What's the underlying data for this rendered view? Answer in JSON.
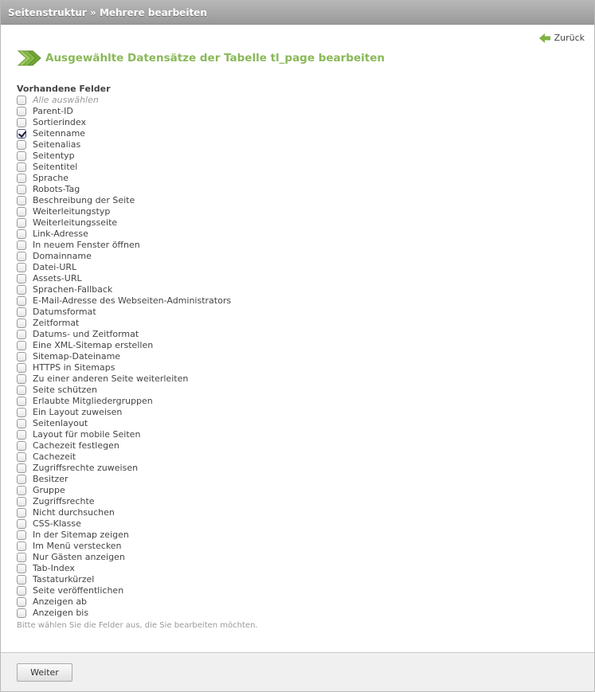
{
  "header": {
    "title": "Seitenstruktur » Mehrere bearbeiten"
  },
  "back_link": {
    "label": "Zurück",
    "icon": "back-arrow-icon"
  },
  "headline": {
    "text": "Ausgewählte Datensätze der Tabelle tl_page bearbeiten",
    "icon": "edit-multiple-arrows-icon"
  },
  "fieldset": {
    "legend": "Vorhandene Felder",
    "select_all": {
      "label": "Alle auswählen",
      "checked": false
    },
    "options": [
      {
        "label": "Parent-ID",
        "checked": false
      },
      {
        "label": "Sortierindex",
        "checked": false
      },
      {
        "label": "Seitenname",
        "checked": true
      },
      {
        "label": "Seitenalias",
        "checked": false
      },
      {
        "label": "Seitentyp",
        "checked": false
      },
      {
        "label": "Seitentitel",
        "checked": false
      },
      {
        "label": "Sprache",
        "checked": false
      },
      {
        "label": "Robots-Tag",
        "checked": false
      },
      {
        "label": "Beschreibung der Seite",
        "checked": false
      },
      {
        "label": "Weiterleitungstyp",
        "checked": false
      },
      {
        "label": "Weiterleitungsseite",
        "checked": false
      },
      {
        "label": "Link-Adresse",
        "checked": false
      },
      {
        "label": "In neuem Fenster öffnen",
        "checked": false
      },
      {
        "label": "Domainname",
        "checked": false
      },
      {
        "label": "Datei-URL",
        "checked": false
      },
      {
        "label": "Assets-URL",
        "checked": false
      },
      {
        "label": "Sprachen-Fallback",
        "checked": false
      },
      {
        "label": "E-Mail-Adresse des Webseiten-Administrators",
        "checked": false
      },
      {
        "label": "Datumsformat",
        "checked": false
      },
      {
        "label": "Zeitformat",
        "checked": false
      },
      {
        "label": "Datums- und Zeitformat",
        "checked": false
      },
      {
        "label": "Eine XML-Sitemap erstellen",
        "checked": false
      },
      {
        "label": "Sitemap-Dateiname",
        "checked": false
      },
      {
        "label": "HTTPS in Sitemaps",
        "checked": false
      },
      {
        "label": "Zu einer anderen Seite weiterleiten",
        "checked": false
      },
      {
        "label": "Seite schützen",
        "checked": false
      },
      {
        "label": "Erlaubte Mitgliedergruppen",
        "checked": false
      },
      {
        "label": "Ein Layout zuweisen",
        "checked": false
      },
      {
        "label": "Seitenlayout",
        "checked": false
      },
      {
        "label": "Layout für mobile Seiten",
        "checked": false
      },
      {
        "label": "Cachezeit festlegen",
        "checked": false
      },
      {
        "label": "Cachezeit",
        "checked": false
      },
      {
        "label": "Zugriffsrechte zuweisen",
        "checked": false
      },
      {
        "label": "Besitzer",
        "checked": false
      },
      {
        "label": "Gruppe",
        "checked": false
      },
      {
        "label": "Zugriffsrechte",
        "checked": false
      },
      {
        "label": "Nicht durchsuchen",
        "checked": false
      },
      {
        "label": "CSS-Klasse",
        "checked": false
      },
      {
        "label": "In der Sitemap zeigen",
        "checked": false
      },
      {
        "label": "Im Menü verstecken",
        "checked": false
      },
      {
        "label": "Nur Gästen anzeigen",
        "checked": false
      },
      {
        "label": "Tab-Index",
        "checked": false
      },
      {
        "label": "Tastaturkürzel",
        "checked": false
      },
      {
        "label": "Seite veröffentlichen",
        "checked": false
      },
      {
        "label": "Anzeigen ab",
        "checked": false
      },
      {
        "label": "Anzeigen bis",
        "checked": false
      }
    ],
    "hint": "Bitte wählen Sie die Felder aus, die Sie bearbeiten möchten."
  },
  "footer": {
    "submit_label": "Weiter"
  },
  "colors": {
    "accent_green": "#8ab858",
    "header_gray": "#a8a8a8",
    "footer_gray": "#f0f0f0"
  }
}
